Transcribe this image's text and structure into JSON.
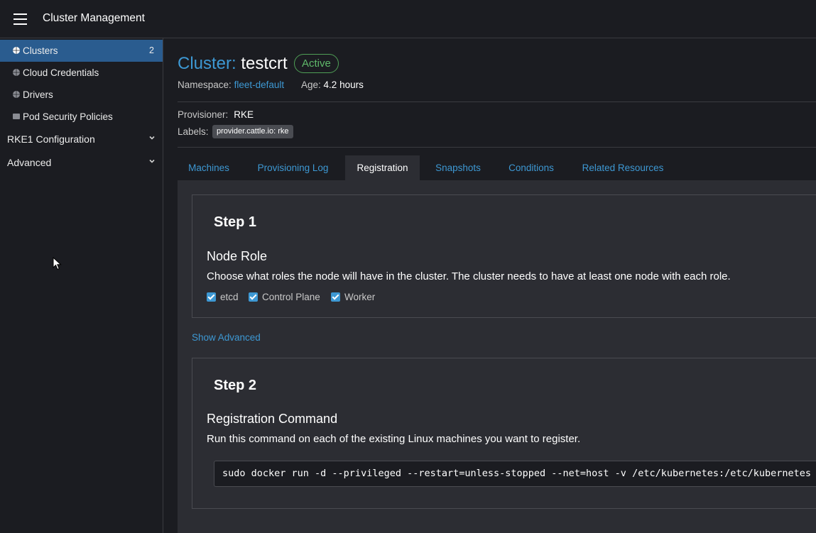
{
  "header": {
    "title": "Cluster Management"
  },
  "sidebar": {
    "items": [
      {
        "label": "Clusters",
        "count": "2",
        "icon": "globe-icon",
        "active": true
      },
      {
        "label": "Cloud Credentials",
        "icon": "globe-icon"
      },
      {
        "label": "Drivers",
        "icon": "globe-icon"
      },
      {
        "label": "Pod Security Policies",
        "icon": "folder-icon"
      }
    ],
    "groups": [
      {
        "label": "RKE1 Configuration",
        "icon": "chevron-down-icon"
      },
      {
        "label": "Advanced",
        "icon": "chevron-down-icon"
      }
    ]
  },
  "cluster": {
    "prefix": "Cluster:",
    "name": "testcrt",
    "status": "Active",
    "namespace_label": "Namespace:",
    "namespace": "fleet-default",
    "age_label": "Age:",
    "age": "4.2 hours",
    "provisioner_label": "Provisioner:",
    "provisioner": "RKE",
    "labels_label": "Labels:",
    "label_chip": "provider.cattle.io: rke"
  },
  "tabs": [
    {
      "label": "Machines"
    },
    {
      "label": "Provisioning Log"
    },
    {
      "label": "Registration",
      "active": true
    },
    {
      "label": "Snapshots"
    },
    {
      "label": "Conditions"
    },
    {
      "label": "Related Resources"
    }
  ],
  "step1": {
    "title": "Step 1",
    "heading": "Node Role",
    "description": "Choose what roles the node will have in the cluster. The cluster needs to have at least one node with each role.",
    "roles": [
      {
        "label": "etcd",
        "checked": true
      },
      {
        "label": "Control Plane",
        "checked": true
      },
      {
        "label": "Worker",
        "checked": true
      }
    ]
  },
  "show_advanced": "Show Advanced",
  "step2": {
    "title": "Step 2",
    "heading": "Registration Command",
    "description": "Run this command on each of the existing Linux machines you want to register.",
    "command": "sudo docker run -d --privileged --restart=unless-stopped --net=host -v /etc/kubernetes:/etc/kubernetes"
  },
  "colors": {
    "accent": "#3d98d3",
    "active_nav": "#2a5c8f",
    "status_active": "#5fb86a",
    "background": "#1b1c21",
    "panel": "#2c2d33"
  }
}
